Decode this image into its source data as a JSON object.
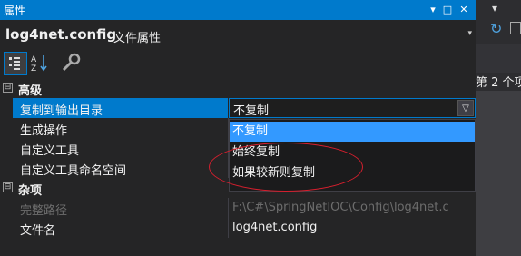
{
  "window": {
    "title": "属性",
    "pin_glyph": "▾",
    "restore_glyph": "□",
    "close_glyph": "✕"
  },
  "object": {
    "name": "log4net.config",
    "type": "文件属性",
    "dropdown_glyph": "▾"
  },
  "toolbar": {
    "icons": [
      "categorized-icon",
      "alphabetical-icon",
      "property-pages-icon"
    ]
  },
  "grid": {
    "categories": [
      {
        "label": "高级",
        "expand_glyph": "⊟",
        "properties": [
          {
            "label": "复制到输出目录",
            "value": "不复制",
            "selected": true
          },
          {
            "label": "生成操作",
            "value": ""
          },
          {
            "label": "自定义工具",
            "value": ""
          },
          {
            "label": "自定义工具命名空间",
            "value": ""
          }
        ]
      },
      {
        "label": "杂项",
        "expand_glyph": "⊟",
        "properties": [
          {
            "label": "完整路径",
            "value": "F:\\C#\\SpringNetIOC\\Config\\log4net.c",
            "disabled": true
          },
          {
            "label": "文件名",
            "value": "log4net.config"
          }
        ]
      }
    ]
  },
  "dropdown": {
    "current": "不复制",
    "arrow_glyph": "▽",
    "options": [
      "不复制",
      "始终复制",
      "如果较新则复制"
    ],
    "highlighted_index": 0
  },
  "right_panel": {
    "strip_glyph": "▾",
    "refresh_glyph": "↻",
    "text": "第 2 个项"
  },
  "colors": {
    "accent": "#007acc",
    "highlight": "#3399ff",
    "annotation": "#d61f2e",
    "background": "#252526"
  }
}
